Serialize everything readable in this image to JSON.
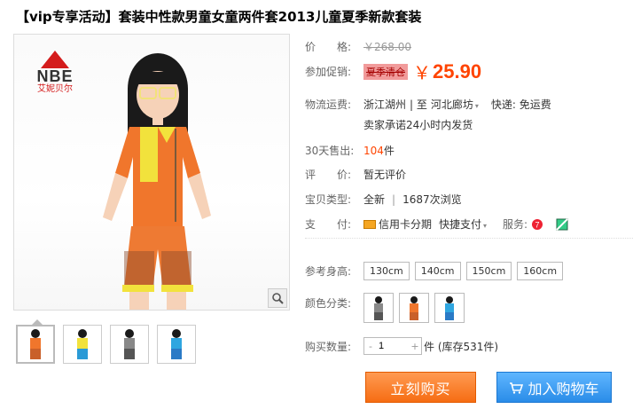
{
  "title": "【vip专享活动】套装中性款男童女童两件套2013儿童夏季新款套装",
  "logo": {
    "brand": "NBE",
    "sub": "艾妮贝尔"
  },
  "price": {
    "label": "价　　格:",
    "original": "￥268.00"
  },
  "promo": {
    "label": "参加促销:",
    "tag": "夏季清仓",
    "currency": "￥",
    "amount": "25.90"
  },
  "shipping": {
    "label": "物流运费:",
    "from": "浙江湖州",
    "sep": "| 至",
    "to": "河北廊坊",
    "to_arrow": "▾",
    "express": "快递: 免运费",
    "promise": "卖家承诺24小时内发货"
  },
  "sales": {
    "label": "30天售出:",
    "count": "104",
    "unit": "件"
  },
  "rating": {
    "label": "评　　价:",
    "value": "暂无评价"
  },
  "item_type": {
    "label": "宝贝类型:",
    "value": "全新",
    "sep": "|",
    "views": "1687次浏览"
  },
  "payment": {
    "label": "支　　付:",
    "credit": "信用卡分期",
    "quick": "快捷支付",
    "quick_arrow": "▾",
    "service_label": "服务:"
  },
  "size": {
    "label": "参考身高:",
    "options": [
      "130cm",
      "140cm",
      "150cm",
      "160cm"
    ]
  },
  "color": {
    "label": "颜色分类:"
  },
  "quantity": {
    "label": "购买数量:",
    "value": "1",
    "dec": "-",
    "inc": "+",
    "stock": "件 (库存531件)"
  },
  "buttons": {
    "buy": "立刻购买",
    "cart": "加入购物车"
  },
  "colors": {
    "accent": "#ff4400",
    "buy": "#f66d13",
    "cart": "#2a8ce8"
  }
}
